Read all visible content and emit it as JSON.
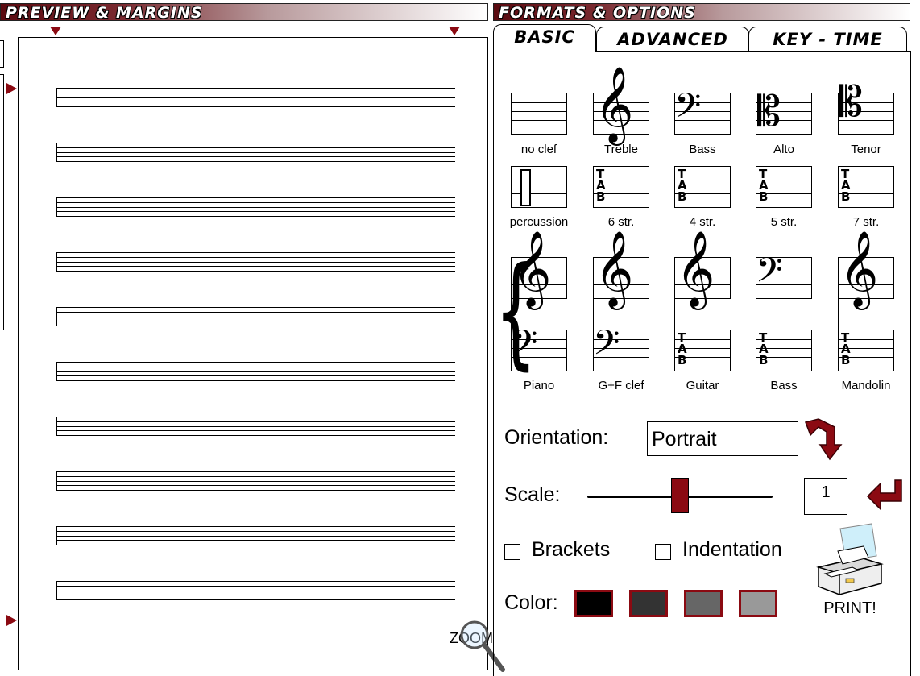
{
  "headers": {
    "left": "PREVIEW & MARGINS",
    "right": "FORMATS & OPTIONS"
  },
  "preview": {
    "zoom_label": "ZOOM"
  },
  "tabs": [
    {
      "label": "BASIC",
      "active": true
    },
    {
      "label": "ADVANCED",
      "active": false
    },
    {
      "label": "KEY - TIME",
      "active": false
    }
  ],
  "clefs_row1": [
    "no clef",
    "Treble",
    "Bass",
    "Alto",
    "Tenor"
  ],
  "clefs_row2": [
    "percussion",
    "6 str.",
    "4 str.",
    "5 str.",
    "7 str."
  ],
  "systems": [
    "Piano",
    "G+F clef",
    "Guitar",
    "Bass",
    "Mandolin"
  ],
  "tab_letters": [
    "T",
    "A",
    "B"
  ],
  "orientation": {
    "label": "Orientation:",
    "value": "Portrait"
  },
  "scale": {
    "label": "Scale:",
    "value": "1",
    "slider_fraction": 0.5
  },
  "options": {
    "brackets": "Brackets",
    "indentation": "Indentation"
  },
  "color": {
    "label": "Color:",
    "swatches": [
      "#000000",
      "#333333",
      "#666666",
      "#999999"
    ],
    "border": "#8b0a12"
  },
  "print_label": "PRINT!",
  "accent": "#8b0a12"
}
